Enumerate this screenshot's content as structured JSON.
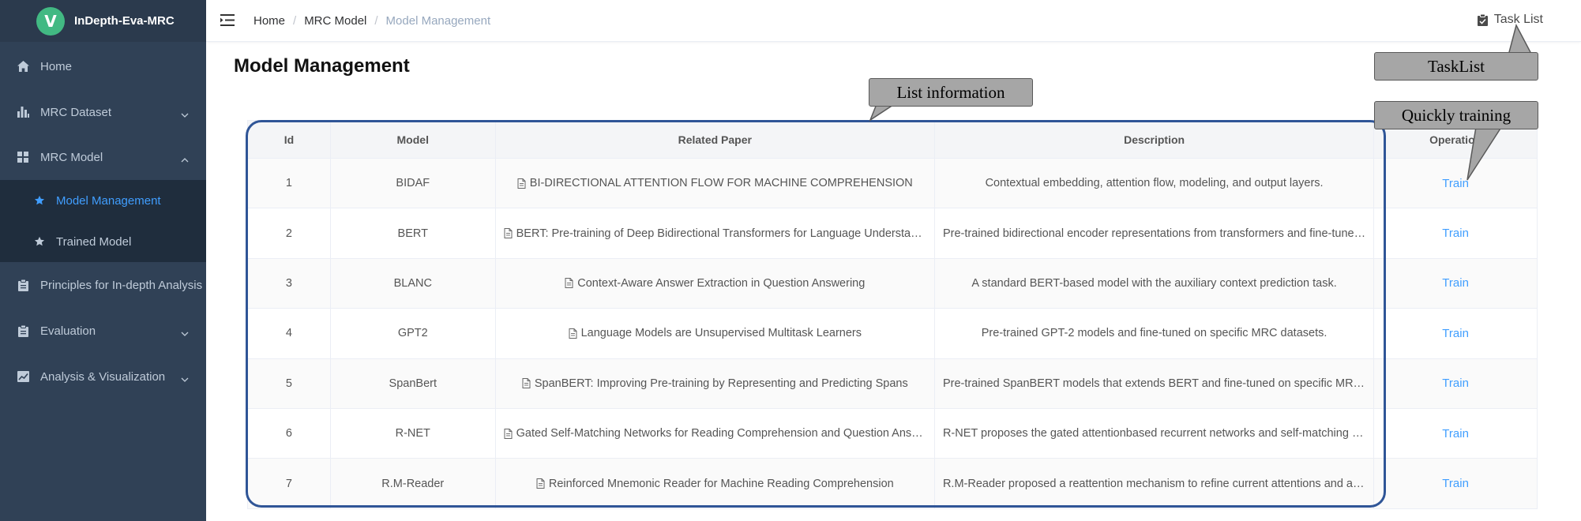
{
  "app": {
    "logo_letter": "V",
    "title": "InDepth-Eva-MRC"
  },
  "sidebar": {
    "items": [
      {
        "label": "Home",
        "icon": "home-icon"
      },
      {
        "label": "MRC Dataset",
        "icon": "bar-chart-icon",
        "expandable": true,
        "expanded": false
      },
      {
        "label": "MRC Model",
        "icon": "grid-icon",
        "expandable": true,
        "expanded": true
      },
      {
        "label": "Principles for In-depth Analysis",
        "icon": "clipboard-icon"
      },
      {
        "label": "Evaluation",
        "icon": "clipboard-icon",
        "expandable": true,
        "expanded": false
      },
      {
        "label": "Analysis & Visualization",
        "icon": "line-chart-icon",
        "expandable": true,
        "expanded": false
      }
    ],
    "subitems": [
      {
        "label": "Model Management",
        "icon": "star-icon",
        "active": true
      },
      {
        "label": "Trained Model",
        "icon": "star-icon",
        "active": false
      }
    ]
  },
  "navbar": {
    "breadcrumb": [
      "Home",
      "MRC Model",
      "Model Management"
    ],
    "separator": "/",
    "task_list": "Task List"
  },
  "page": {
    "title": "Model Management"
  },
  "table": {
    "columns": [
      "Id",
      "Model",
      "Related Paper",
      "Description",
      "Operation"
    ],
    "rows": [
      {
        "id": "1",
        "model": "BIDAF",
        "paper": "BI-DIRECTIONAL ATTENTION FLOW FOR MACHINE COMPREHENSION",
        "description": "Contextual embedding, attention flow, modeling, and output layers.",
        "action": "Train"
      },
      {
        "id": "2",
        "model": "BERT",
        "paper": "BERT: Pre-training of Deep Bidirectional Transformers for Language Understanding",
        "description": "Pre-trained bidirectional encoder representations from transformers and fine-tuned on specific MRC datasets.",
        "action": "Train"
      },
      {
        "id": "3",
        "model": "BLANC",
        "paper": "Context-Aware Answer Extraction in Question Answering",
        "description": "A standard BERT-based model with the auxiliary context prediction task.",
        "action": "Train"
      },
      {
        "id": "4",
        "model": "GPT2",
        "paper": "Language Models are Unsupervised Multitask Learners",
        "description": "Pre-trained GPT-2 models and fine-tuned on specific MRC datasets.",
        "action": "Train"
      },
      {
        "id": "5",
        "model": "SpanBert",
        "paper": "SpanBERT: Improving Pre-training by Representing and Predicting Spans",
        "description": "Pre-trained SpanBERT models that extends BERT and fine-tuned on specific MRC datasets.",
        "action": "Train"
      },
      {
        "id": "6",
        "model": "R-NET",
        "paper": "Gated Self-Matching Networks for Reading Comprehension and Question Answering",
        "description": "R-NET proposes the gated attentionbased recurrent networks and self-matching attention mechanism.",
        "action": "Train"
      },
      {
        "id": "7",
        "model": "R.M-Reader",
        "paper": "Reinforced Mnemonic Reader for Machine Reading Comprehension",
        "description": "R.M-Reader proposed a reattention mechanism to refine current attentions and alignment.",
        "action": "Train"
      }
    ]
  },
  "annotations": {
    "list_information": "List information",
    "tasklist": "TaskList",
    "quickly_training": "Quickly training"
  },
  "colors": {
    "sidebar_bg": "#304156",
    "submenu_bg": "#1f2d3d",
    "accent": "#409eff",
    "logo_green": "#42b983",
    "annotation_fill": "#a6a6a6",
    "annotation_outline": "#2f5597"
  }
}
